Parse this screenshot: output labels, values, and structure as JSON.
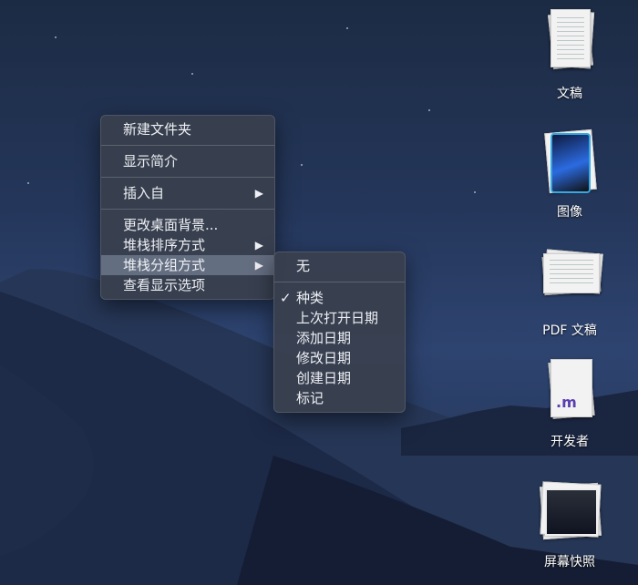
{
  "context_menu": {
    "items": [
      {
        "label": "新建文件夹"
      },
      {
        "label": "显示简介"
      },
      {
        "label": "插入自",
        "submenu_arrow": "▶"
      },
      {
        "label": "更改桌面背景..."
      },
      {
        "label": "堆栈排序方式",
        "submenu_arrow": "▶"
      },
      {
        "label": "堆栈分组方式",
        "submenu_arrow": "▶"
      },
      {
        "label": "查看显示选项"
      }
    ]
  },
  "group_submenu": {
    "items": [
      {
        "label": "无"
      },
      {
        "label": "种类",
        "checked": "✓"
      },
      {
        "label": "上次打开日期"
      },
      {
        "label": "添加日期"
      },
      {
        "label": "修改日期"
      },
      {
        "label": "创建日期"
      },
      {
        "label": "标记"
      }
    ]
  },
  "desktop_stacks": [
    {
      "label": "文稿",
      "icon": "documents-stack-icon"
    },
    {
      "label": "图像",
      "icon": "images-stack-icon"
    },
    {
      "label": "PDF 文稿",
      "icon": "pdf-stack-icon"
    },
    {
      "label": "开发者",
      "icon": "developer-stack-icon",
      "badge": ".m"
    },
    {
      "label": "屏幕快照",
      "icon": "screenshots-stack-icon"
    }
  ],
  "colors": {
    "menu_bg": "#3a404e",
    "highlight": "#7d879b",
    "image_frame": "#39a8e0"
  }
}
